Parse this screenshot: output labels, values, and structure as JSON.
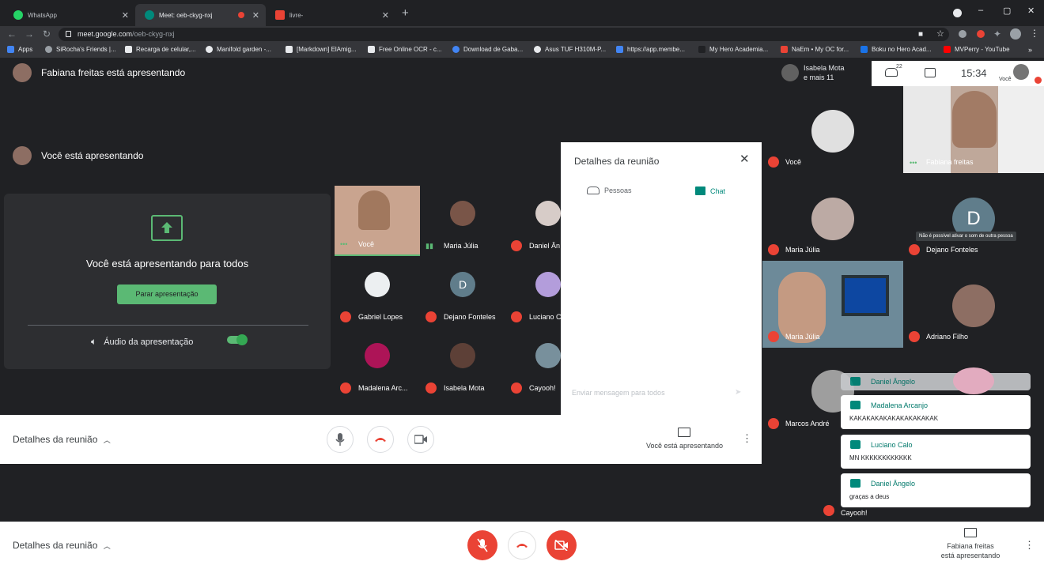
{
  "browser": {
    "tabs": [
      {
        "title": "WhatsApp",
        "color": "#25d366"
      },
      {
        "title": "Meet: oeb-ckyg-nxj",
        "color": "#00897b"
      },
      {
        "title": "livre-",
        "color": "#ea4335"
      }
    ],
    "url_host": "meet.google.com",
    "url_path": "/oeb-ckyg-nxj",
    "bookmarks": [
      {
        "label": "Apps",
        "color": "#e8eaed"
      },
      {
        "label": "SiRocha's Friends |...",
        "color": "#9aa0a6"
      },
      {
        "label": "Recarga de celular,...",
        "color": "#e8eaed"
      },
      {
        "label": "Manifold garden -...",
        "color": "#e8eaed"
      },
      {
        "label": "[Markdown] ElAmig...",
        "color": "#e8eaed"
      },
      {
        "label": "Free Online OCR - c...",
        "color": "#e8eaed"
      },
      {
        "label": "Download de Gaba...",
        "color": "#4285f4"
      },
      {
        "label": "Asus TUF H310M-P...",
        "color": "#e8eaed"
      },
      {
        "label": "https://app.membe...",
        "color": "#4285f4"
      },
      {
        "label": "My Hero Academia...",
        "color": "#202124"
      },
      {
        "label": "NaEm • My OC for...",
        "color": "#ea4335"
      },
      {
        "label": "Boku no Hero Acad...",
        "color": "#1a73e8"
      },
      {
        "label": "MVPerry - YouTube",
        "color": "#ff0000"
      }
    ]
  },
  "meet": {
    "presenting_banner_1": "Fabiana freitas está apresentando",
    "presenting_banner_2": "Você está apresentando",
    "presentation_card": {
      "heading": "Você está apresentando para todos",
      "stop_button": "Parar apresentação",
      "audio_label": "Áudio da apresentação"
    },
    "grid": [
      {
        "name": "Você",
        "muted": false,
        "initial": ""
      },
      {
        "name": "Maria Júlia",
        "muted": false,
        "initial": ""
      },
      {
        "name": "Daniel Ân",
        "muted": true,
        "initial": ""
      },
      {
        "name": "Gabriel Lopes",
        "muted": true,
        "initial": ""
      },
      {
        "name": "Dejano Fonteles",
        "muted": true,
        "initial": "D"
      },
      {
        "name": "Luciano C",
        "muted": true,
        "initial": ""
      },
      {
        "name": "Madalena Arc...",
        "muted": true,
        "initial": ""
      },
      {
        "name": "Isabela Mota",
        "muted": true,
        "initial": ""
      },
      {
        "name": "Cayooh!",
        "muted": true,
        "initial": ""
      }
    ],
    "details_panel": {
      "title": "Detalhes da reunião",
      "tab_people": "Pessoas",
      "tab_chat": "Chat",
      "input_placeholder": "Enviar mensagem para todos"
    },
    "inner_bar": {
      "details": "Detalhes da reunião",
      "present_label": "Você está apresentando"
    },
    "top_info": {
      "name": "Isabela Mota",
      "others": "e mais 11",
      "participants_count": "22",
      "clock": "15:34",
      "self_label": "Você"
    },
    "right_tiles": [
      {
        "name": "Você",
        "initial": ""
      },
      {
        "name": "Fabiana freitas",
        "initial": ""
      },
      {
        "name": "Maria Júlia",
        "initial": ""
      },
      {
        "name": "Dejano Fonteles",
        "initial": "D"
      },
      {
        "name": "Maria Júlia",
        "initial": ""
      },
      {
        "name": "Adriano Filho",
        "initial": ""
      },
      {
        "name": "Marcos André",
        "initial": ""
      },
      {
        "name": "Cayooh!",
        "initial": ""
      }
    ],
    "tooltip": "Não é possível ativar o som de outra pessoa",
    "chat_toasts": [
      {
        "author": "Daniel Ângelo",
        "text": ""
      },
      {
        "author": "Madalena Arcanjo",
        "text": "KAKAKAKAKAKAKAKAKAKAK"
      },
      {
        "author": "Luciano Calo",
        "text": "MN KKKKKKKKKKKK"
      },
      {
        "author": "Daniel Ângelo",
        "text": "graças a deus"
      }
    ],
    "bottom_bar": {
      "details": "Detalhes da reunião",
      "present_line1": "Fabiana freitas",
      "present_line2": "está apresentando"
    }
  },
  "colors": {
    "accent_green": "#5bb974",
    "danger_red": "#ea4335",
    "chat_teal": "#00897b"
  }
}
